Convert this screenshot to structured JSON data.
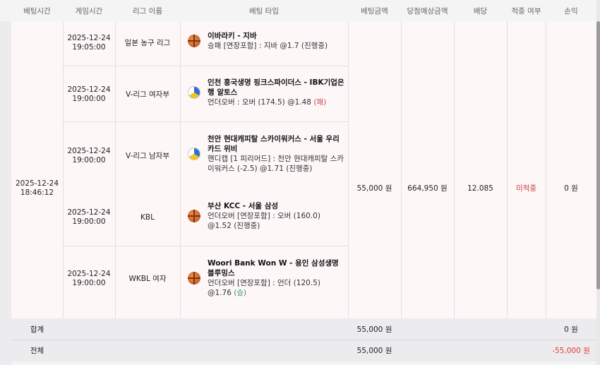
{
  "header": {
    "bet_time": "베팅시간",
    "game_time": "게임시간",
    "league": "리그 이름",
    "bet_type": "베팅 타입",
    "bet_amount": "베팅금액",
    "expected_win": "당첨예상금액",
    "odds": "배당",
    "hit": "적중 여부",
    "profit": "손익"
  },
  "bet": {
    "time_date": "2025-12-24",
    "time_clock": "18:46:12",
    "amount": "55,000 원",
    "expected": "664,950 원",
    "odds": "12.085",
    "hit_status": "미적중",
    "profit": "0 원",
    "status_color": "#c83a3a"
  },
  "games": [
    {
      "date": "2025-12-24",
      "clock": "19:05:00",
      "league": "일본 농구 리그",
      "icon": "basketball-icon",
      "title": "이바라키 - 지바",
      "selection": "승패 [연장포함] : 지바 @1.7",
      "result": "(진행중)"
    },
    {
      "date": "2025-12-24",
      "clock": "19:00:00",
      "league": "V-리그 여자부",
      "icon": "volleyball-icon",
      "title": "인천 흥국생명 핑크스파이더스 - IBK기업은행 알토스",
      "selection": "언더오버 : 오버 (174.5) @1.48",
      "result": "(패)"
    },
    {
      "date": "2025-12-24",
      "clock": "19:00:00",
      "league": "V-리그 남자부",
      "icon": "volleyball-icon",
      "title": "천안 현대캐피탈 스카이워커스 - 서울 우리카드 위비",
      "selection": "핸디캡 [1 피리어드] : 천안 현대캐피탈 스카이워커스 (-2.5) @1.71",
      "result": "(진행중)"
    },
    {
      "date": "2025-12-24",
      "clock": "19:00:00",
      "league": "KBL",
      "icon": "basketball-icon",
      "title": "부산 KCC - 서울 삼성",
      "selection": "언더오버 [연장포함] : 오버 (160.0) @1.52",
      "result": "(진행중)"
    },
    {
      "date": "2025-12-24",
      "clock": "19:00:00",
      "league": "WKBL 여자",
      "icon": "basketball-icon",
      "title": "Woori Bank Won W - 용인 삼성생명 블루밍스",
      "selection": "언더오버 [연장포함] : 언더 (120.5) @1.76",
      "result": "(승)"
    }
  ],
  "summary": {
    "subtotal_label": "합계",
    "subtotal_amount": "55,000 원",
    "subtotal_profit": "0 원",
    "total_label": "전체",
    "total_amount": "55,000 원",
    "total_profit": "-55,000 원",
    "negative_color": "#e03a3a"
  }
}
